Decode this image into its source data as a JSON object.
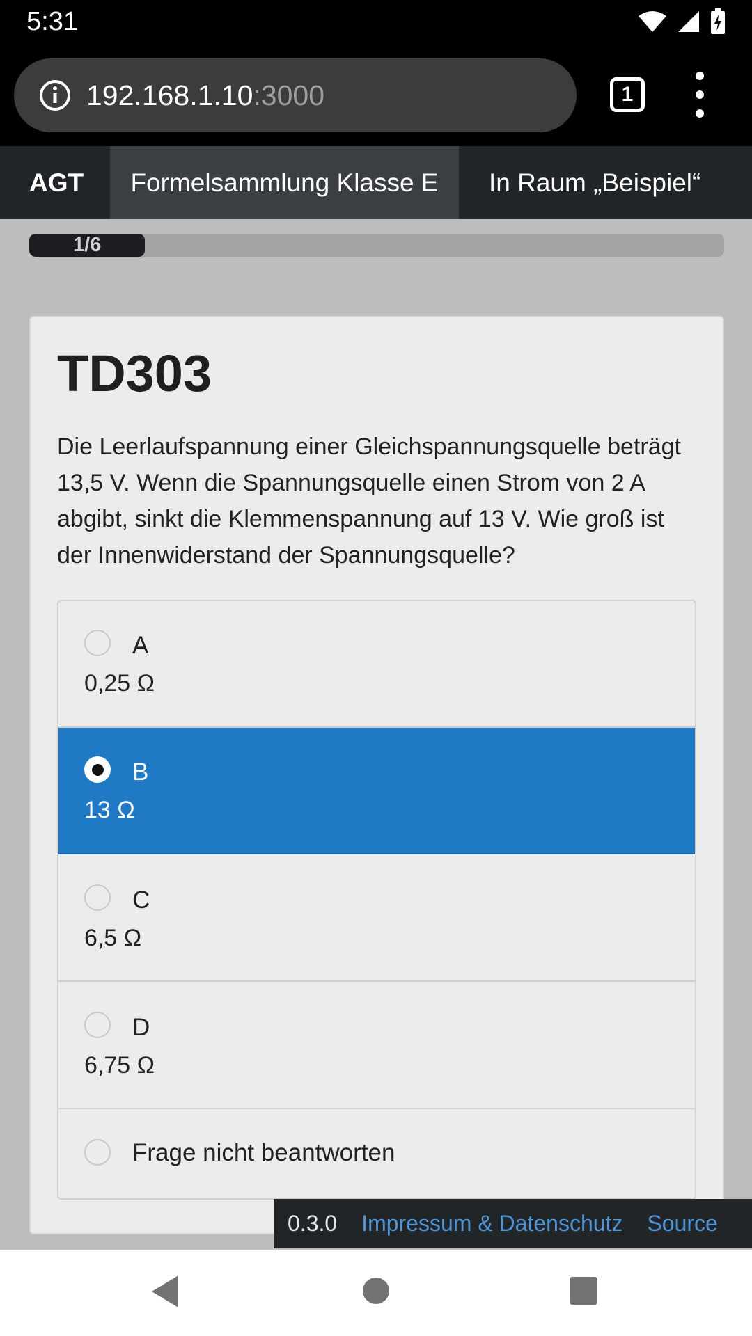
{
  "status_bar": {
    "time": "5:31",
    "icons": [
      "wifi-icon",
      "cell-signal-icon",
      "battery-charging-icon"
    ]
  },
  "browser": {
    "url_host": "192.168.1.10",
    "url_port": ":3000",
    "tab_count": "1",
    "icons": [
      "info-icon",
      "tabs-icon",
      "overflow-menu-icon"
    ]
  },
  "navbar": {
    "brand": "AGT",
    "active_item": "Formelsammlung Klasse E",
    "room_item": "In Raum „Beispiel“"
  },
  "progress": {
    "label": "1/6",
    "fraction": 0.1667
  },
  "question": {
    "id": "TD303",
    "text": "Die Leerlaufspannung einer Gleichspannungsquelle beträgt 13,5 V. Wenn die Spannungsquelle einen Strom von 2 A abgibt, sinkt die Klemmenspannung auf 13 V. Wie groß ist der Innenwiderstand der Spannungsquelle?",
    "options": [
      {
        "letter": "A",
        "value": "0,25 Ω",
        "selected": false
      },
      {
        "letter": "B",
        "value": "13 Ω",
        "selected": true
      },
      {
        "letter": "C",
        "value": "6,5 Ω",
        "selected": false
      },
      {
        "letter": "D",
        "value": "6,75 Ω",
        "selected": false
      }
    ],
    "skip_label": "Frage nicht beantworten"
  },
  "footer": {
    "version": "0.3.0",
    "privacy_link": "Impressum & Datenschutz",
    "source_link": "Source"
  },
  "colors": {
    "selected_option": "#2079c4",
    "navbar_bg": "#222528",
    "link": "#4f95d6"
  }
}
